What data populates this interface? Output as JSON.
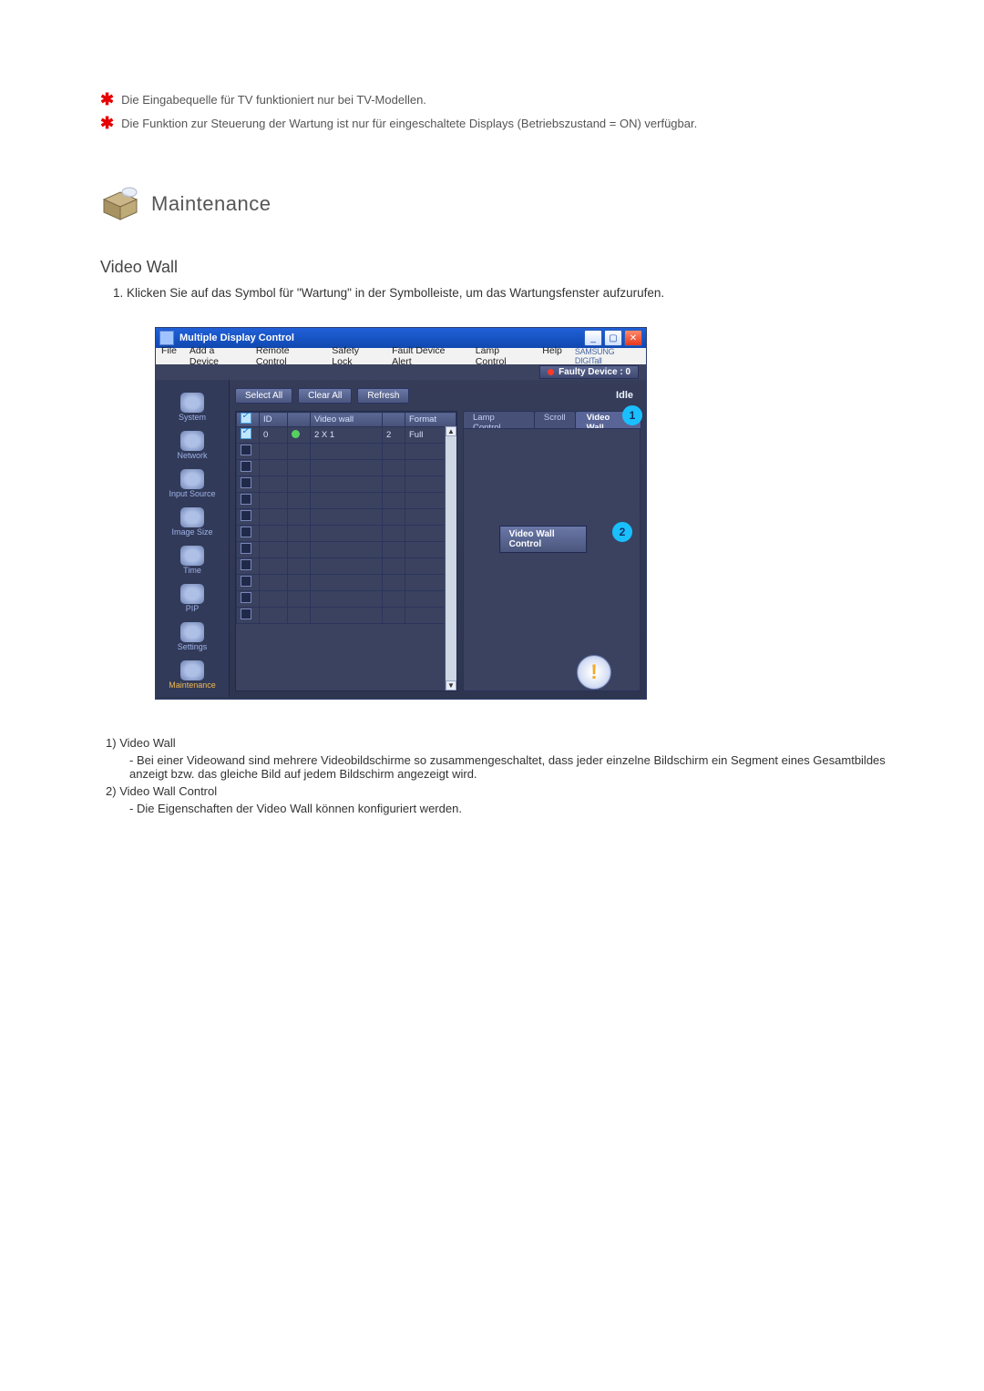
{
  "notes": {
    "n1": "Die Eingabequelle für TV funktioniert nur bei TV-Modellen.",
    "n2": "Die Funktion zur Steuerung der Wartung ist nur für eingeschaltete Displays (Betriebszustand = ON) verfügbar."
  },
  "section": {
    "title": "Maintenance"
  },
  "sub": {
    "title": "Video Wall",
    "intro_label": "1.",
    "intro": "Klicken Sie auf das Symbol für \"Wartung\" in der Symbolleiste, um das Wartungsfenster aufzurufen."
  },
  "win": {
    "title": "Multiple Display Control",
    "menu": {
      "file": "File",
      "add": "Add a Device",
      "remote": "Remote Control",
      "safety": "Safety Lock",
      "fault": "Fault Device Alert",
      "lamp": "Lamp Control",
      "help": "Help"
    },
    "brand": "SAMSUNG DIGITall",
    "faulty": "Faulty Device : 0",
    "btn": {
      "select_all": "Select All",
      "clear_all": "Clear All",
      "refresh": "Refresh"
    },
    "idle": "Idle",
    "sidebar": [
      "System",
      "Network",
      "Input Source",
      "Image Size",
      "Time",
      "PIP",
      "Settings",
      "Maintenance"
    ],
    "cols": {
      "id": "ID",
      "vw": "Video wall",
      "fmt": "Format"
    },
    "row": {
      "id": "0",
      "vw": "2 X 1",
      "num": "2",
      "fmt": "Full"
    },
    "tabs": {
      "lamp": "Lamp Control",
      "scroll": "Scroll",
      "video": "Video Wall"
    },
    "vwcontrol": "Video Wall Control"
  },
  "legend": {
    "l1_num": "1)",
    "l1_title": "Video Wall",
    "l1_body": "- Bei einer Videowand sind mehrere Videobildschirme so zusammengeschaltet, dass jeder einzelne Bildschirm ein Segment eines Gesamtbildes anzeigt bzw. das gleiche Bild auf jedem Bildschirm angezeigt wird.",
    "l2_num": "2)",
    "l2_title": "Video Wall Control",
    "l2_body": "- Die Eigenschaften der Video Wall können konfiguriert werden."
  }
}
